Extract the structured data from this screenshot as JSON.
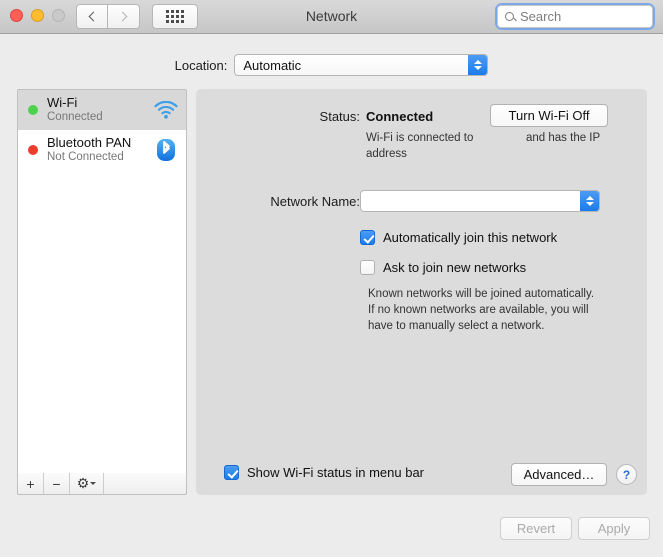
{
  "window": {
    "title": "Network",
    "traffic_lights": [
      "close-button",
      "minimize-button",
      "zoom-button"
    ],
    "nav": {
      "back_icon": "chevron-left-icon",
      "forward_icon": "chevron-right-icon"
    },
    "grid_icon": "grid-view-icon"
  },
  "search": {
    "placeholder": "Search",
    "value": "",
    "icon": "search-icon",
    "focus_ring_color": "#7aa8e8"
  },
  "location": {
    "label": "Location:",
    "value": "Automatic",
    "options": [
      "Automatic"
    ],
    "chevron_icon": "up-down-chevron-icon"
  },
  "sidebar": {
    "items": [
      {
        "name": "Wi-Fi",
        "state": "Connected",
        "dot_color": "#4cd24c",
        "icon": "wifi-icon",
        "selected": true
      },
      {
        "name": "Bluetooth PAN",
        "state": "Not Connected",
        "dot_color": "#f03c2e",
        "icon": "bluetooth-icon",
        "selected": false
      }
    ],
    "toolbar": {
      "add_label": "+",
      "remove_label": "−",
      "gear_label": "⚙",
      "add_icon": "plus-icon",
      "remove_icon": "minus-icon",
      "gear_icon": "gear-icon"
    }
  },
  "main": {
    "status_label": "Status:",
    "status_value": "Connected",
    "toggle_button": "Turn Wi-Fi Off",
    "status_desc_left": "Wi-Fi is connected to",
    "status_desc_left2": "address",
    "status_desc_right": "and has the IP",
    "network_name_label": "Network Name:",
    "network_name_value": "",
    "checkbox_auto_join": {
      "label": "Automatically join this network",
      "checked": true
    },
    "checkbox_ask_join": {
      "label": "Ask to join new networks",
      "checked": false
    },
    "help_text": "Known networks will be joined automatically. If no known networks are available, you will have to manually select a network.",
    "checkbox_menu_bar": {
      "label": "Show Wi-Fi status in menu bar",
      "checked": true
    },
    "advanced_button": "Advanced…",
    "help_button": "?",
    "accent_color": "#1b7cec"
  },
  "footer": {
    "revert_button": "Revert",
    "apply_button": "Apply",
    "revert_enabled": false,
    "apply_enabled": false
  }
}
